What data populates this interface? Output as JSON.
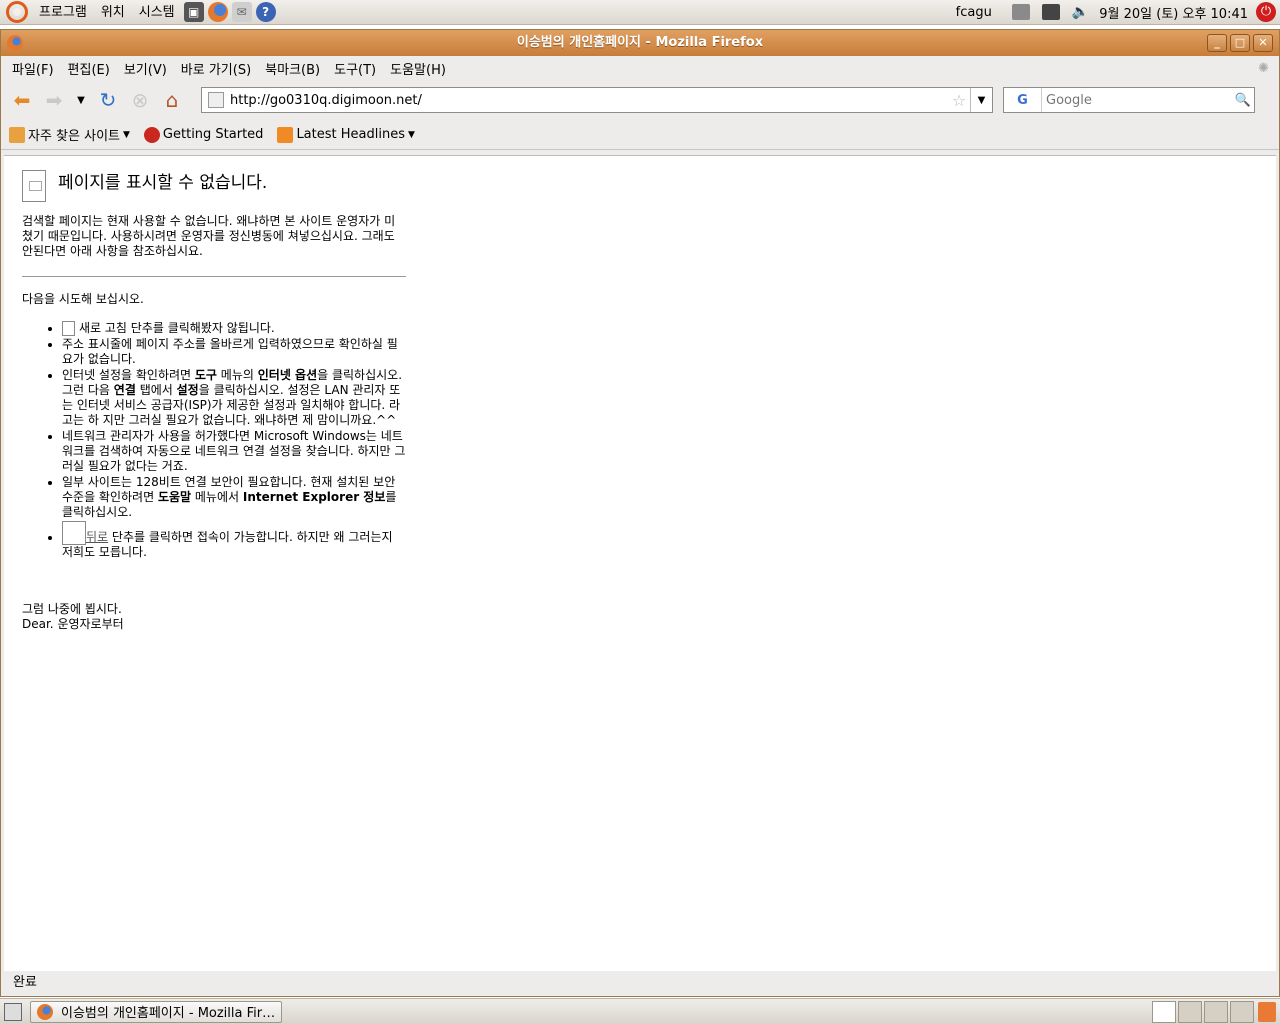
{
  "top_panel": {
    "menus": [
      "프로그램",
      "위치",
      "시스템"
    ],
    "launchers": [
      "camera-icon",
      "firefox-icon",
      "mail-icon",
      "help-icon"
    ],
    "user": "fcagu",
    "datetime": "9월 20일 (토) 오후 10:41"
  },
  "window": {
    "title": "이승범의 개인홈페이지 - Mozilla Firefox",
    "menu": [
      "파일(F)",
      "편집(E)",
      "보기(V)",
      "바로 가기(S)",
      "북마크(B)",
      "도구(T)",
      "도움말(H)"
    ],
    "url": "http://go0310q.digimoon.net/",
    "search_placeholder": "Google",
    "search_engine": "G",
    "bookmarks": [
      "자주 찾은 사이트",
      "Getting Started",
      "Latest Headlines"
    ],
    "status": "완료"
  },
  "page": {
    "title": "페이지를 표시할 수 없습니다.",
    "intro": "검색할 페이지는 현재 사용할 수 없습니다. 왜냐하면 본 사이트 운영자가 미쳤기 때문입니다. 사용하시려면 운영자를 정신병동에 쳐넣으십시요. 그래도 안된다면 아래 사항을 참조하십시요.",
    "try_heading": "다음을 시도해 보십시오.",
    "tip1": "새로 고침 단추를 클릭해봤자 않됩니다.",
    "tip2": "주소 표시줄에 페이지 주소를 올바르게 입력하였으므로 확인하실 필요가 없습니다.",
    "tip3_a": "인터넷 설정을 확인하려면 ",
    "tip3_b": "도구",
    "tip3_c": " 메뉴의 ",
    "tip3_d": "인터넷 옵션",
    "tip3_e": "을 클릭하십시오. 그런 다음 ",
    "tip3_f": "연결",
    "tip3_g": " 탭에서 ",
    "tip3_h": "설정",
    "tip3_i": "을 클릭하십시오. 설정은 LAN 관리자 또는 인터넷 서비스 공급자(ISP)가 제공한 설정과 일치해야 합니다. 라고는 하 지만 그러실 필요가 없습니다. 왜냐하면 제 맘이니까요.^^",
    "tip4": "네트워크 관리자가 사용을 허가했다면 Microsoft Windows는 네트워크를 검색하여 자동으로 네트워크 연결 설정을 찾습니다. 하지만 그러실 필요가 없다는 거죠.",
    "tip5_a": "일부 사이트는 128비트 연결 보안이 필요합니다. 현재 설치된 보안 수준을 확인하려면 ",
    "tip5_b": "도움말",
    "tip5_c": " 메뉴에서 ",
    "tip5_d": "Internet Explorer 정보",
    "tip5_e": "를 클릭하십시오.",
    "tip6_link": "뒤로",
    "tip6_text": " 단추를 클릭하면 접속이 가능합니다. 하지만 왜 그러는지 저희도 모릅니다.",
    "closing1": "그럼 나중에 뵙시다.",
    "closing2": "Dear. 운영자로부터"
  },
  "bottom_panel": {
    "task_label": "이승범의 개인홈페이지 - Mozilla Fir…"
  },
  "colors": {
    "titlebar": "#c87d3a",
    "panel": "#dcd8d0"
  }
}
